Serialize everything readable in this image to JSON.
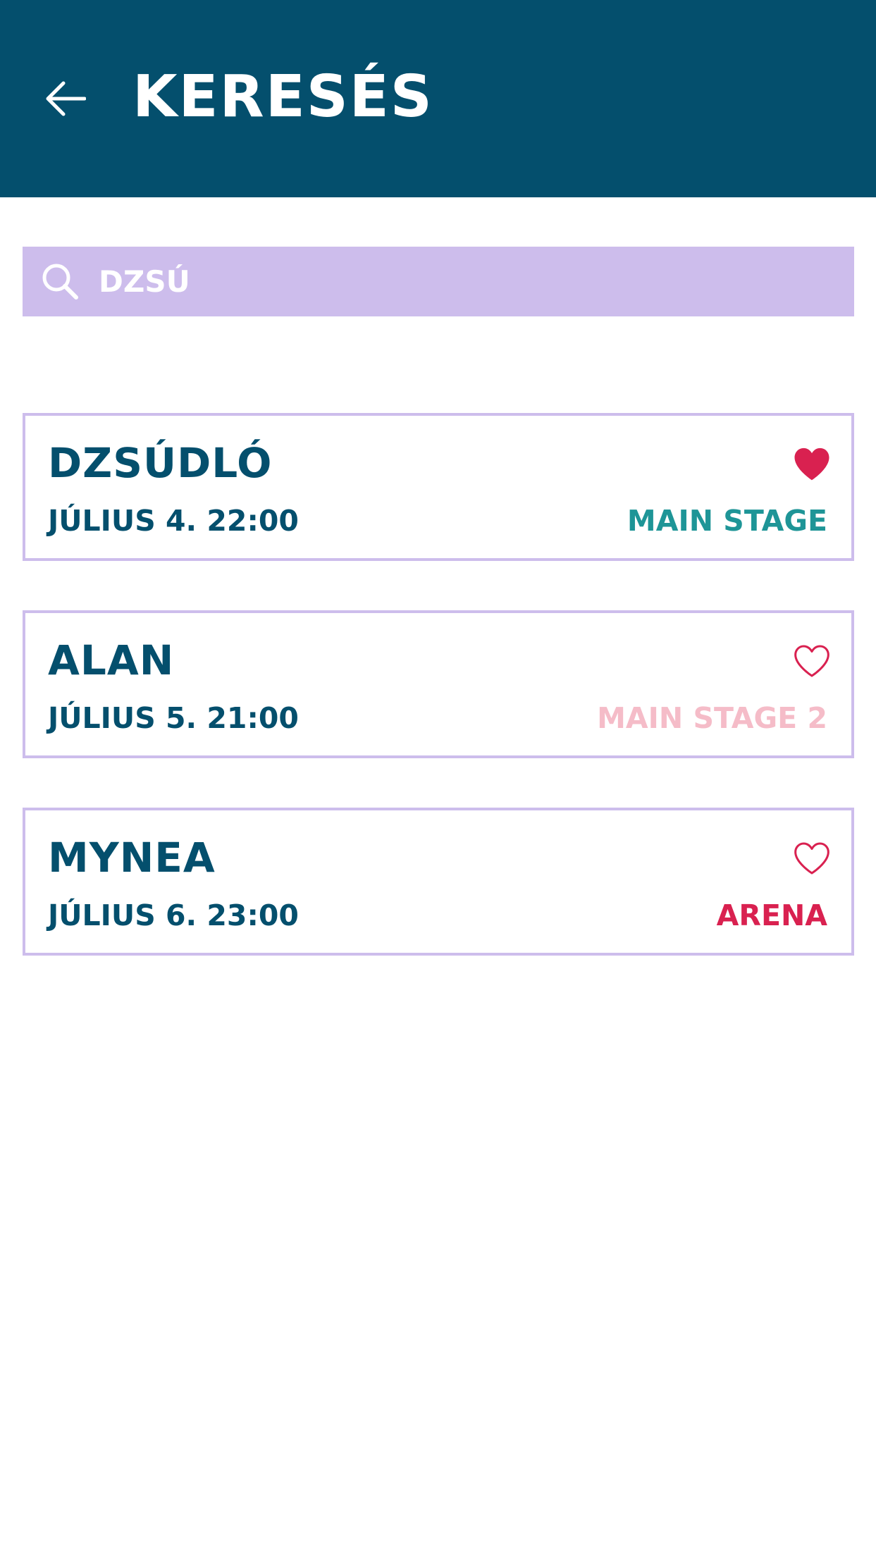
{
  "colors": {
    "header_bg": "#044f6d",
    "search_bg": "#cdbdec",
    "card_border": "#cdbdec",
    "text_primary": "#044f6d",
    "heart": "#d92150"
  },
  "header": {
    "back_icon": "arrow-left-icon",
    "title": "KERESÉS"
  },
  "search": {
    "icon": "search-icon",
    "value": "DZSÚ"
  },
  "results": [
    {
      "name": "DZSÚDLÓ",
      "date": "JÚLIUS 4. 22:00",
      "stage": "MAIN STAGE",
      "stage_color": "#1e9597",
      "favorite": true
    },
    {
      "name": "ALAN",
      "date": "JÚLIUS 5. 21:00",
      "stage": "MAIN STAGE 2",
      "stage_color": "#f5bcc8",
      "favorite": false
    },
    {
      "name": "MYNEA",
      "date": "JÚLIUS 6. 23:00",
      "stage": "ARENA",
      "stage_color": "#d92150",
      "favorite": false
    }
  ]
}
